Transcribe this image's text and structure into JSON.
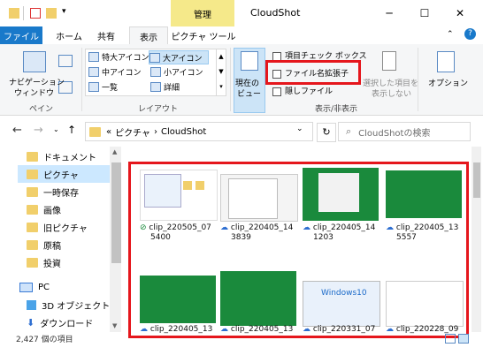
{
  "title": {
    "manage": "管理",
    "window": "CloudShot",
    "min": "─",
    "max": "☐",
    "close": "✕"
  },
  "tabs": [
    "ファイル",
    "ホーム",
    "共有",
    "表示",
    "ピクチャ ツール"
  ],
  "ribbon": {
    "navpane": "ナビゲーション",
    "navpane2": "ウィンドウ",
    "pane_group": "ペイン",
    "layout": [
      "特大アイコン",
      "大アイコン",
      "中アイコン",
      "小アイコン",
      "一覧",
      "詳細"
    ],
    "layout_group": "レイアウト",
    "currentview": "現在の",
    "currentview2": "ビュー",
    "check1": "項目チェック ボックス",
    "check2": "ファイル名拡張子",
    "check3": "隠しファイル",
    "hide1": "選択した項目を",
    "hide2": "表示しない",
    "showhide_group": "表示/非表示",
    "options": "オプション"
  },
  "address": {
    "path1": "«",
    "path2": "ピクチャ",
    "path3": "CloudShot"
  },
  "search_placeholder": "CloudShotの検索",
  "nav": [
    "ドキュメント",
    "ピクチャ",
    "一時保存",
    "画像",
    "旧ピクチャ",
    "原稿",
    "投資",
    "PC",
    "3D オブジェクト",
    "ダウンロード"
  ],
  "files": [
    {
      "name": "clip_220505_07",
      "name2": "5400"
    },
    {
      "name": "clip_220405_14",
      "name2": "3839"
    },
    {
      "name": "clip_220405_14",
      "name2": "1203"
    },
    {
      "name": "clip_220405_13",
      "name2": "5557"
    },
    {
      "name": "clip_220405_13",
      "name2": ""
    },
    {
      "name": "clip_220405_13",
      "name2": ""
    },
    {
      "name": "clip_220331_07",
      "name2": ""
    },
    {
      "name": "clip_220228_09",
      "name2": ""
    }
  ],
  "thumb_text": {
    "windows10": "Windows10"
  },
  "status": "2,427 個の項目",
  "colors": {
    "accent": "#1979ca",
    "highlight": "#e5161c",
    "manage": "#f5e98a",
    "green": "#1a8a3c"
  }
}
